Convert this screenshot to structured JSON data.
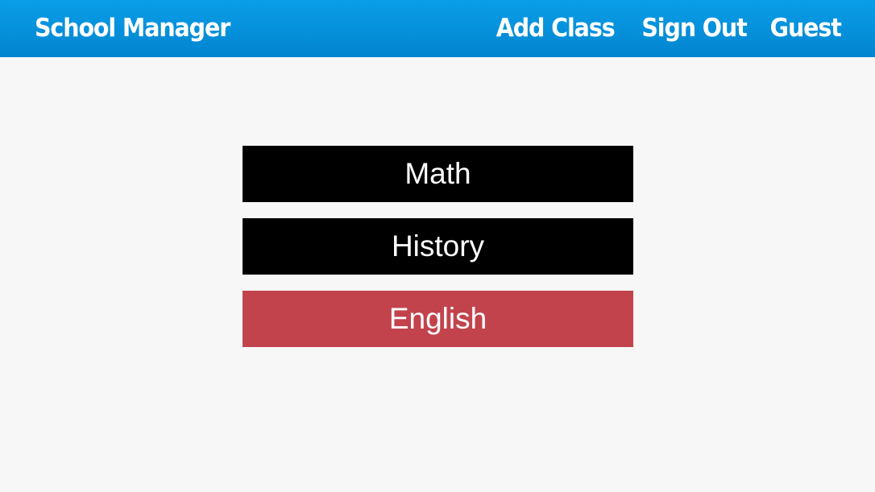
{
  "header": {
    "brand": "School Manager",
    "nav": {
      "add_class": "Add Class",
      "sign_out": "Sign Out",
      "user": "Guest"
    },
    "colors": {
      "gradient_top": "#0a9ee8",
      "gradient_bottom": "#0284cf",
      "text": "#ffffff"
    }
  },
  "classes": [
    {
      "label": "Math",
      "color": "#000000"
    },
    {
      "label": "History",
      "color": "#000000"
    },
    {
      "label": "English",
      "color": "#c2434c"
    }
  ],
  "page": {
    "background": "#f7f7f7"
  }
}
